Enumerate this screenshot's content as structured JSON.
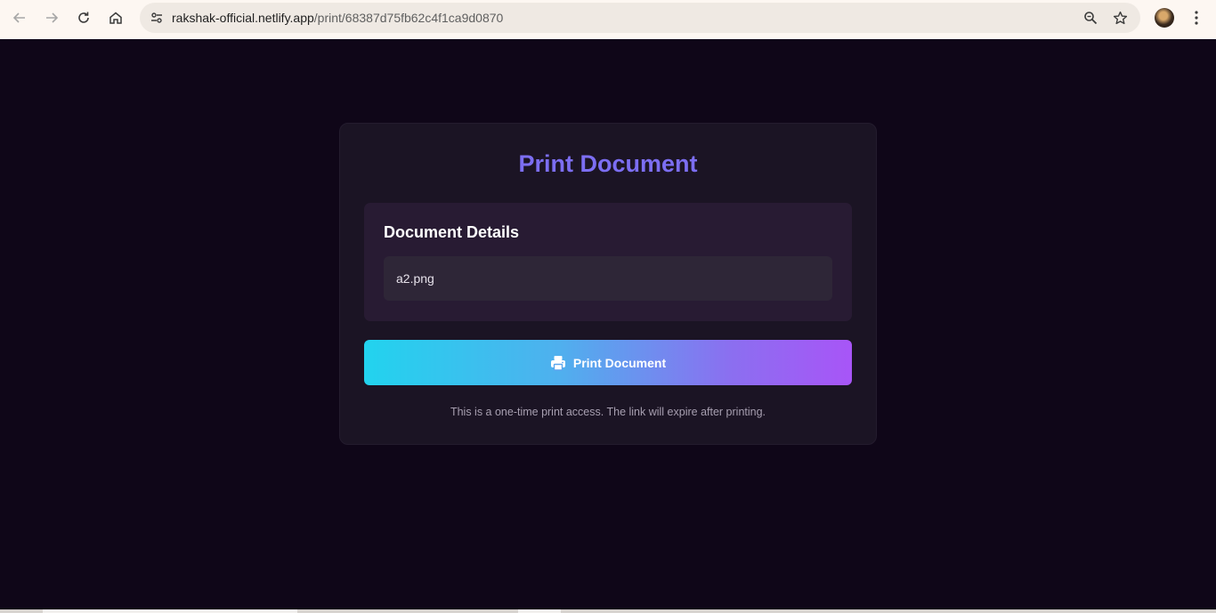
{
  "browser": {
    "url_host": "rakshak-official.netlify.app",
    "url_path": "/print/68387d75fb62c4f1ca9d0870",
    "icons": {
      "back": "back-arrow-icon",
      "forward": "forward-arrow-icon",
      "reload": "reload-icon",
      "home": "home-icon",
      "site_info": "site-settings-icon",
      "zoom": "zoom-icon",
      "bookmark": "star-icon",
      "profile": "avatar",
      "menu": "kebab-menu-icon"
    }
  },
  "card": {
    "title": "Print Document",
    "details_title": "Document Details",
    "file_name": "a2.png",
    "print_button_label": "Print Document",
    "note": "This is a one-time print access. The link will expire after printing."
  },
  "colors": {
    "page_bg": "#0f0618",
    "card_bg": "#1b1424",
    "title": "#7c6ef2",
    "button_gradient_start": "#22d3ee",
    "button_gradient_end": "#a855f7"
  }
}
